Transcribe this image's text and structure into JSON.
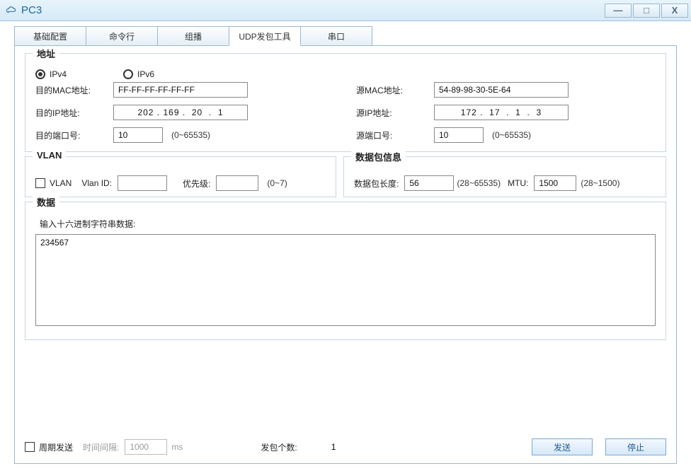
{
  "window": {
    "title": "PC3"
  },
  "tabs": {
    "items": [
      {
        "label": "基础配置"
      },
      {
        "label": "命令行"
      },
      {
        "label": "组播"
      },
      {
        "label": "UDP发包工具"
      },
      {
        "label": "串口"
      }
    ],
    "active_index": 3
  },
  "address": {
    "legend": "地址",
    "ip_version": {
      "ipv4_label": "IPv4",
      "ipv6_label": "IPv6",
      "selected": "ipv4"
    },
    "dst_mac_label": "目的MAC地址:",
    "dst_mac": "FF-FF-FF-FF-FF-FF",
    "src_mac_label": "源MAC地址:",
    "src_mac": "54-89-98-30-5E-64",
    "dst_ip_label": "目的IP地址:",
    "dst_ip": "202 . 169 .  20  .  1",
    "src_ip_label": "源IP地址:",
    "src_ip": "172 .  17  .  1  .  3",
    "dst_port_label": "目的端口号:",
    "dst_port": "10",
    "src_port_label": "源端口号:",
    "src_port": "10",
    "port_range_hint": "(0~65535)"
  },
  "vlan": {
    "legend": "VLAN",
    "checkbox_label": "VLAN",
    "checked": false,
    "vlan_id_label": "Vlan ID:",
    "vlan_id": "",
    "priority_label": "优先级:",
    "priority": "",
    "priority_hint": "(0~7)"
  },
  "packet_info": {
    "legend": "数据包信息",
    "length_label": "数据包长度:",
    "length": "56",
    "length_hint": "(28~65535)",
    "mtu_label": "MTU:",
    "mtu": "1500",
    "mtu_hint": "(28~1500)"
  },
  "payload": {
    "legend": "数据",
    "hex_label": "输入十六进制字符串数据:",
    "hex_value": "234567"
  },
  "footer": {
    "periodic_label": "周期发送",
    "periodic_checked": false,
    "interval_label": "时间间隔:",
    "interval_value": "1000",
    "interval_unit": "ms",
    "count_label": "发包个数:",
    "count_value": "1",
    "send_label": "发送",
    "stop_label": "停止"
  }
}
